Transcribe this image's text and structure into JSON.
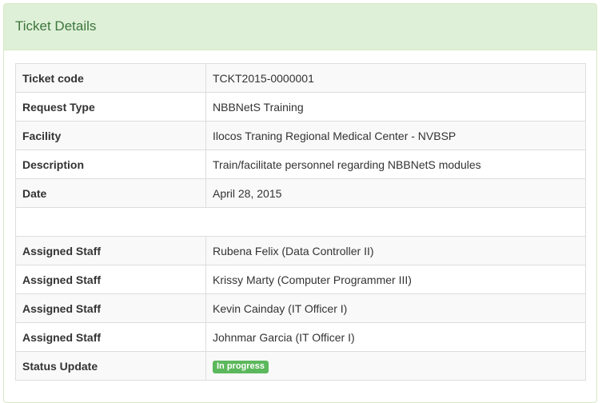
{
  "panel": {
    "title": "Ticket Details"
  },
  "rows": [
    {
      "label": "Ticket code",
      "value": "TCKT2015-0000001"
    },
    {
      "label": "Request Type",
      "value": "NBBNetS Training"
    },
    {
      "label": "Facility",
      "value": "Ilocos Traning Regional Medical Center - NVBSP"
    },
    {
      "label": "Description",
      "value": "Train/facilitate personnel regarding NBBNetS modules"
    },
    {
      "label": "Date",
      "value": "April 28, 2015"
    }
  ],
  "staff": [
    {
      "label": "Assigned Staff",
      "value": "Rubena Felix (Data Controller II)"
    },
    {
      "label": "Assigned Staff",
      "value": "Krissy Marty (Computer Programmer III)"
    },
    {
      "label": "Assigned Staff",
      "value": "Kevin Cainday (IT Officer I)"
    },
    {
      "label": "Assigned Staff",
      "value": "Johnmar Garcia (IT Officer I)"
    }
  ],
  "status": {
    "label": "Status Update",
    "value": "In progress",
    "color": "#5cb85c"
  },
  "colors": {
    "heading_bg": "#dff0d8",
    "heading_text": "#3c763d",
    "border": "#d6e9c6",
    "stripe": "#f9f9f9"
  }
}
